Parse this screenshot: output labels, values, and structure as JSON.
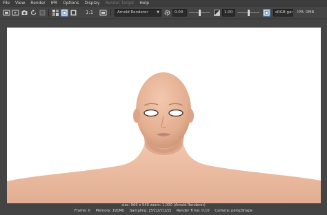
{
  "menu": [
    "File",
    "View",
    "Render",
    "IPR",
    "Options",
    "Display",
    "Render Target",
    "Help"
  ],
  "menu_disabled": [
    false,
    false,
    false,
    false,
    false,
    false,
    true,
    false
  ],
  "toolbar": {
    "ratio_label": "1:1",
    "renderer": "Arnold Renderer",
    "exposure": "0.00",
    "gamma": "1.00",
    "colorspace": "sRGB gamma",
    "ipr_status": "IPR: 0MB"
  },
  "icons": [
    "render-icon",
    "ipr-render-icon",
    "snapshot-icon",
    "refresh-icon",
    "stop-icon",
    "channels-icon",
    "rgb-icon",
    "alpha-icon",
    "one-to-one-icon",
    "fit-icon",
    "gear-icon",
    "exposure-icon",
    "color-manage-icon"
  ],
  "status": {
    "info": "size: 960 x 540  zoom: 1.000   (Arnold Renderer)",
    "frame": "Frame: 0",
    "memory": "Memory: 191Mb",
    "sampling": "Sampling: [3/2/2/2/2/2]",
    "render_time": "Render Time: 0:10",
    "camera": "Camera: perspShape"
  },
  "colors": {
    "background": "#444444",
    "menubar": "#3c3c3c",
    "viewport": "#ffffff",
    "skin": "#e9b79a",
    "accent_blue": "#5a8fc6"
  }
}
